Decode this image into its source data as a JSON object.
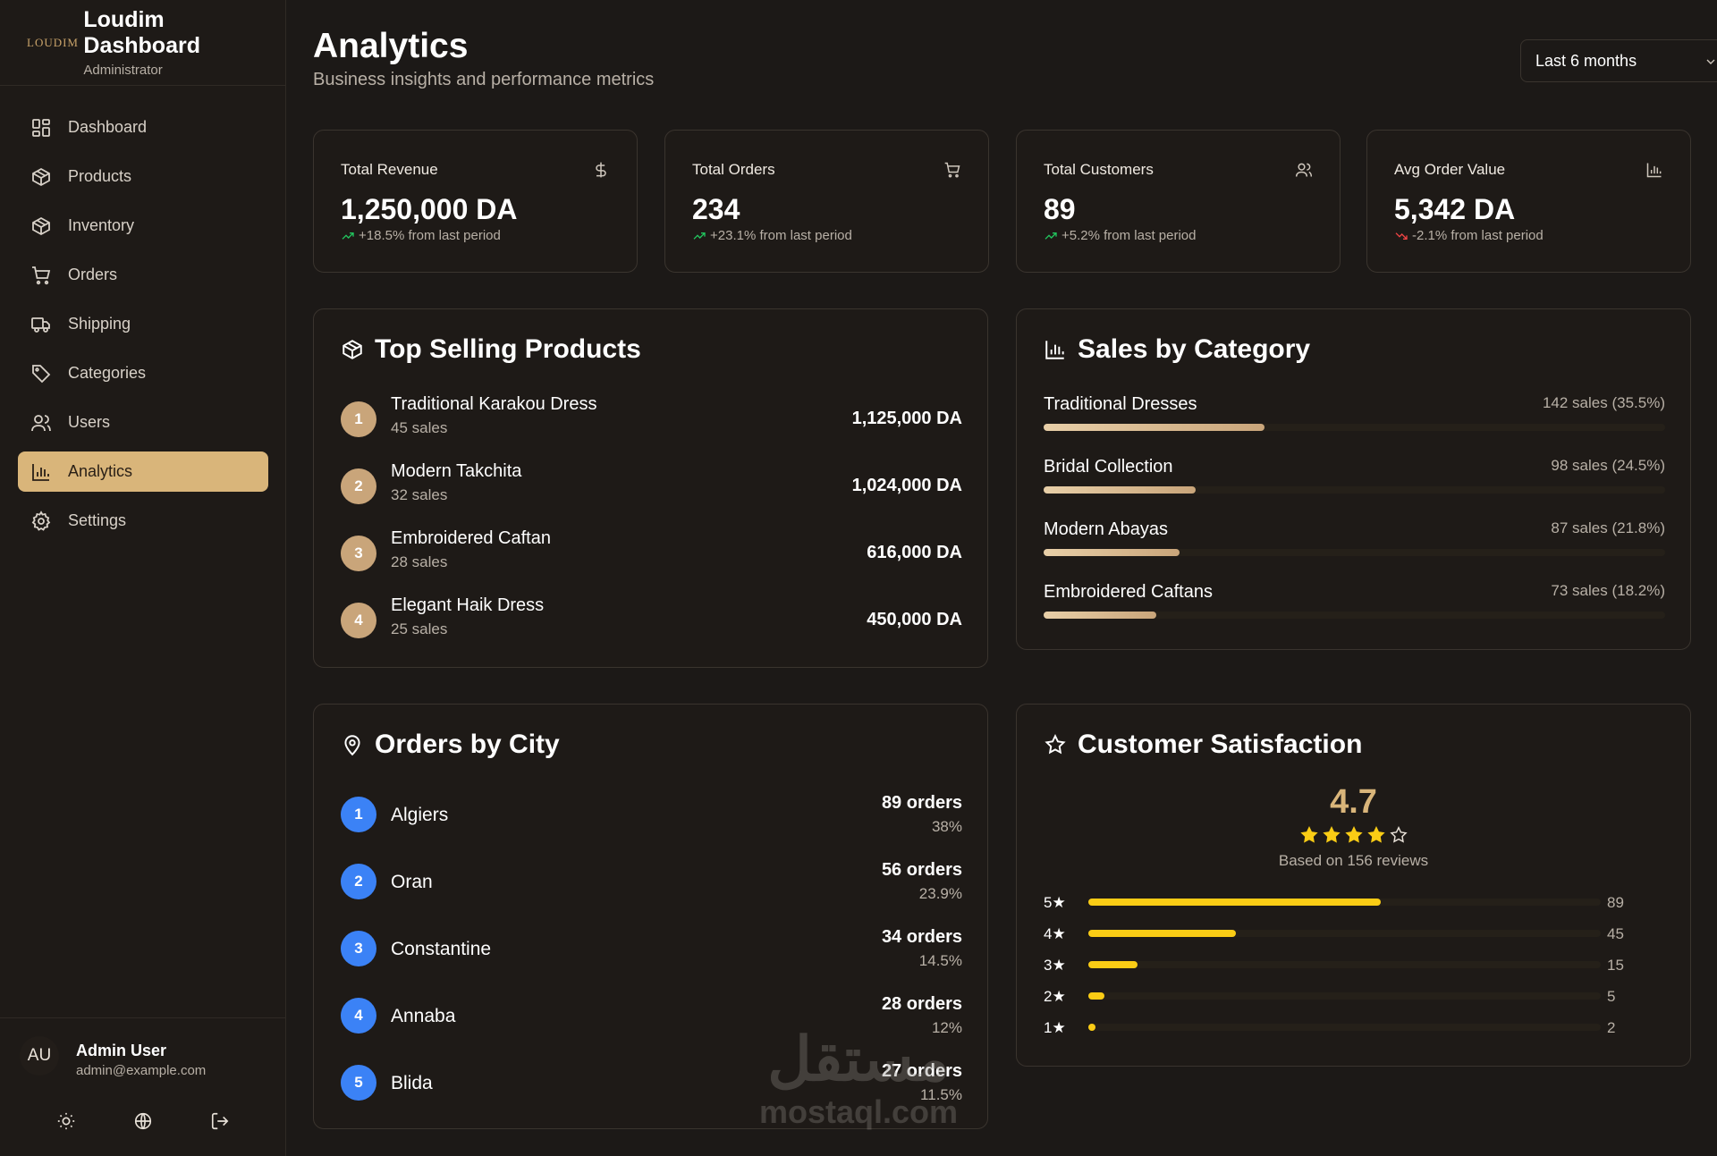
{
  "brand": {
    "logo": "LOUDIM",
    "title": "Loudim Dashboard",
    "role": "Administrator"
  },
  "nav": [
    {
      "label": "Dashboard",
      "icon": "grid-icon",
      "active": false
    },
    {
      "label": "Products",
      "icon": "box-icon",
      "active": false
    },
    {
      "label": "Inventory",
      "icon": "box-icon",
      "active": false
    },
    {
      "label": "Orders",
      "icon": "cart-icon",
      "active": false
    },
    {
      "label": "Shipping",
      "icon": "truck-icon",
      "active": false
    },
    {
      "label": "Categories",
      "icon": "tag-icon",
      "active": false
    },
    {
      "label": "Users",
      "icon": "users-icon",
      "active": false
    },
    {
      "label": "Analytics",
      "icon": "bar-chart-icon",
      "active": true
    },
    {
      "label": "Settings",
      "icon": "gear-icon",
      "active": false
    }
  ],
  "user": {
    "initials": "AU",
    "name": "Admin User",
    "email": "admin@example.com"
  },
  "header": {
    "title": "Analytics",
    "subtitle": "Business insights and performance metrics",
    "period": "Last 6 months"
  },
  "stats": [
    {
      "label": "Total Revenue",
      "value": "1,250,000 DA",
      "change": "+18.5% from last period",
      "trend": "up",
      "icon": "dollar-icon"
    },
    {
      "label": "Total Orders",
      "value": "234",
      "change": "+23.1% from last period",
      "trend": "up",
      "icon": "cart-icon"
    },
    {
      "label": "Total Customers",
      "value": "89",
      "change": "+5.2% from last period",
      "trend": "up",
      "icon": "users-icon"
    },
    {
      "label": "Avg Order Value",
      "value": "5,342 DA",
      "change": "-2.1% from last period",
      "trend": "down",
      "icon": "bar-chart-icon"
    }
  ],
  "top_products": {
    "title": "Top Selling Products",
    "items": [
      {
        "rank": "1",
        "name": "Traditional Karakou Dress",
        "sales": "45 sales",
        "amount": "1,125,000 DA"
      },
      {
        "rank": "2",
        "name": "Modern Takchita",
        "sales": "32 sales",
        "amount": "1,024,000 DA"
      },
      {
        "rank": "3",
        "name": "Embroidered Caftan",
        "sales": "28 sales",
        "amount": "616,000 DA"
      },
      {
        "rank": "4",
        "name": "Elegant Haik Dress",
        "sales": "25 sales",
        "amount": "450,000 DA"
      }
    ]
  },
  "sales_by_category": {
    "title": "Sales by Category",
    "items": [
      {
        "name": "Traditional Dresses",
        "meta": "142 sales (35.5%)",
        "percent": 35.5
      },
      {
        "name": "Bridal Collection",
        "meta": "98 sales (24.5%)",
        "percent": 24.5
      },
      {
        "name": "Modern Abayas",
        "meta": "87 sales (21.8%)",
        "percent": 21.8
      },
      {
        "name": "Embroidered Caftans",
        "meta": "73 sales (18.2%)",
        "percent": 18.2
      }
    ]
  },
  "orders_by_city": {
    "title": "Orders by City",
    "items": [
      {
        "rank": "1",
        "city": "Algiers",
        "orders": "89 orders",
        "percent": "38%"
      },
      {
        "rank": "2",
        "city": "Oran",
        "orders": "56 orders",
        "percent": "23.9%"
      },
      {
        "rank": "3",
        "city": "Constantine",
        "orders": "34 orders",
        "percent": "14.5%"
      },
      {
        "rank": "4",
        "city": "Annaba",
        "orders": "28 orders",
        "percent": "12%"
      },
      {
        "rank": "5",
        "city": "Blida",
        "orders": "27 orders",
        "percent": "11.5%"
      }
    ]
  },
  "satisfaction": {
    "title": "Customer Satisfaction",
    "rating": "4.7",
    "filled_stars": 4,
    "reviews": "Based on 156 reviews",
    "rows": [
      {
        "label": "5★",
        "count": "89",
        "value": 89
      },
      {
        "label": "4★",
        "count": "45",
        "value": 45
      },
      {
        "label": "3★",
        "count": "15",
        "value": 15
      },
      {
        "label": "2★",
        "count": "5",
        "value": 5
      },
      {
        "label": "1★",
        "count": "2",
        "value": 2
      }
    ]
  },
  "watermark": {
    "arabic": "مستقل",
    "latin": "mostaql.com"
  },
  "colors": {
    "accent": "#d9b57a",
    "up": "#22c55e",
    "down": "#ef4444",
    "star": "#facc15",
    "city_badge": "#3b82f6"
  }
}
